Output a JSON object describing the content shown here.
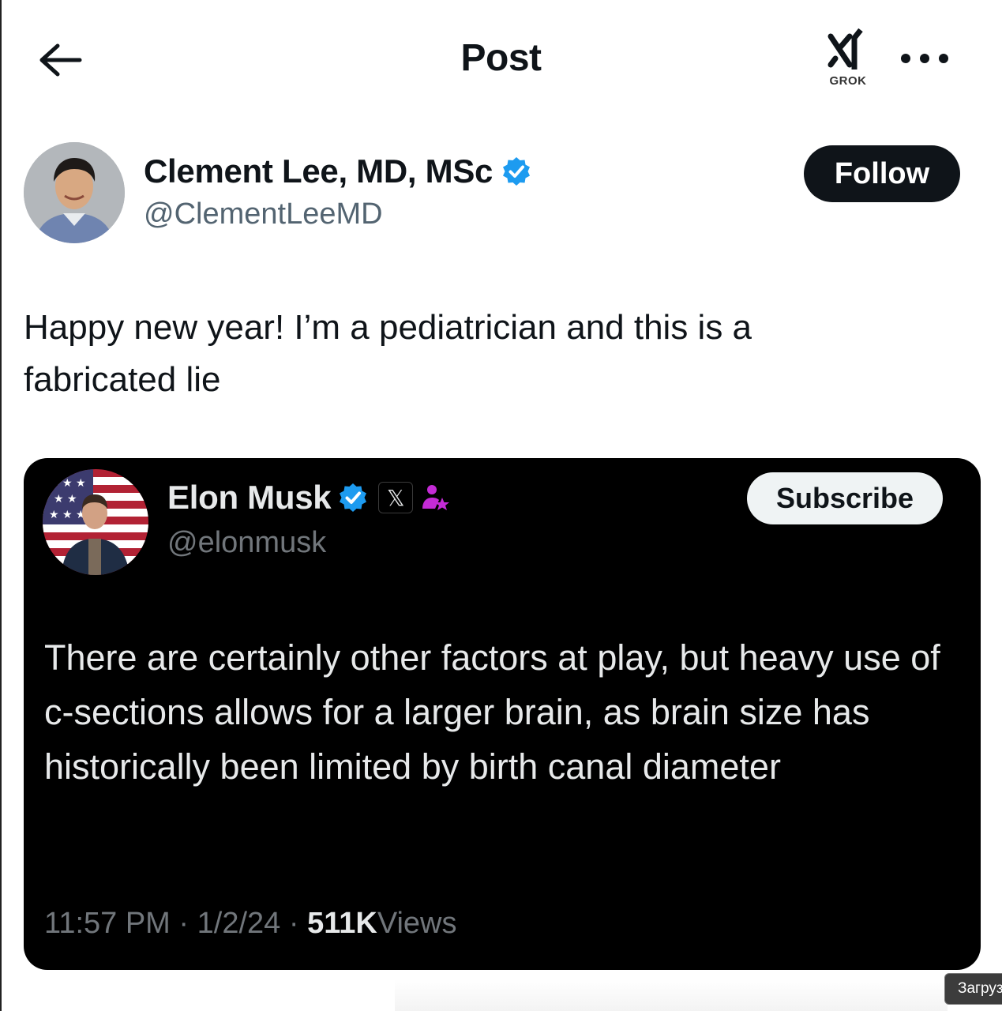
{
  "header": {
    "title": "Post",
    "grok_label": "GROK"
  },
  "author": {
    "name": "Clement Lee, MD, MSc",
    "handle": "@ClementLeeMD",
    "follow_label": "Follow",
    "verified": true
  },
  "post": {
    "text": "Happy new year! I’m a pediatrician and this is a fabricated lie"
  },
  "quoted": {
    "name": "Elon Musk",
    "handle": "@elonmusk",
    "subscribe_label": "Subscribe",
    "badge_x": "𝕏",
    "text": "There are certainly other factors at play, but heavy use of c-sections allows for a larger brain, as brain size has historically been limited by birth canal diameter",
    "time": "11:57 PM",
    "date": "1/2/24",
    "views_count": "511K",
    "views_label": "Views",
    "separator": " · "
  },
  "tooltip": {
    "text": "Загруз"
  },
  "colors": {
    "verified_blue": "#1d9bf0",
    "affiliate_magenta": "#c42bd6",
    "dark_bg": "#000000"
  }
}
